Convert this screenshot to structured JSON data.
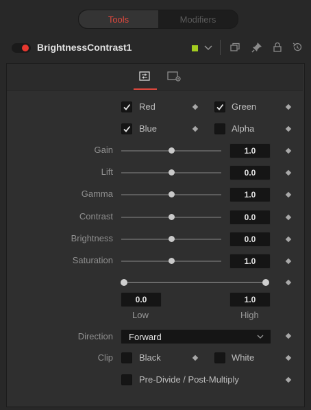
{
  "tabs": {
    "tools": "Tools",
    "modifiers": "Modifiers"
  },
  "header": {
    "tool_name": "BrightnessContrast1",
    "color_chip": "#a3cc20",
    "icons": [
      "chevron-down-icon",
      "copy-icon",
      "pin-icon",
      "lock-icon",
      "reset-icon"
    ]
  },
  "subtabs": {
    "icons": [
      "controls-icon",
      "settings-icon"
    ]
  },
  "channels": {
    "red": {
      "label": "Red",
      "checked": true
    },
    "green": {
      "label": "Green",
      "checked": true
    },
    "blue": {
      "label": "Blue",
      "checked": true
    },
    "alpha": {
      "label": "Alpha",
      "checked": false
    }
  },
  "sliders": [
    {
      "label": "Gain",
      "value": "1.0",
      "level": 0.5
    },
    {
      "label": "Lift",
      "value": "0.0",
      "level": 0.5
    },
    {
      "label": "Gamma",
      "value": "1.0",
      "level": 0.5
    },
    {
      "label": "Contrast",
      "value": "0.0",
      "level": 0.5
    },
    {
      "label": "Brightness",
      "value": "0.0",
      "level": 0.5
    },
    {
      "label": "Saturation",
      "value": "1.0",
      "level": 0.5
    }
  ],
  "range": {
    "low_value": "0.0",
    "high_value": "1.0",
    "low_label": "Low",
    "high_label": "High"
  },
  "direction": {
    "label": "Direction",
    "value": "Forward"
  },
  "clip": {
    "label": "Clip",
    "black": {
      "label": "Black",
      "checked": false
    },
    "white": {
      "label": "White",
      "checked": false
    }
  },
  "predivide": {
    "label": "Pre-Divide / Post-Multiply",
    "checked": false
  },
  "colors": {
    "accent": "#e0483e",
    "toggle": "#e8382f"
  }
}
